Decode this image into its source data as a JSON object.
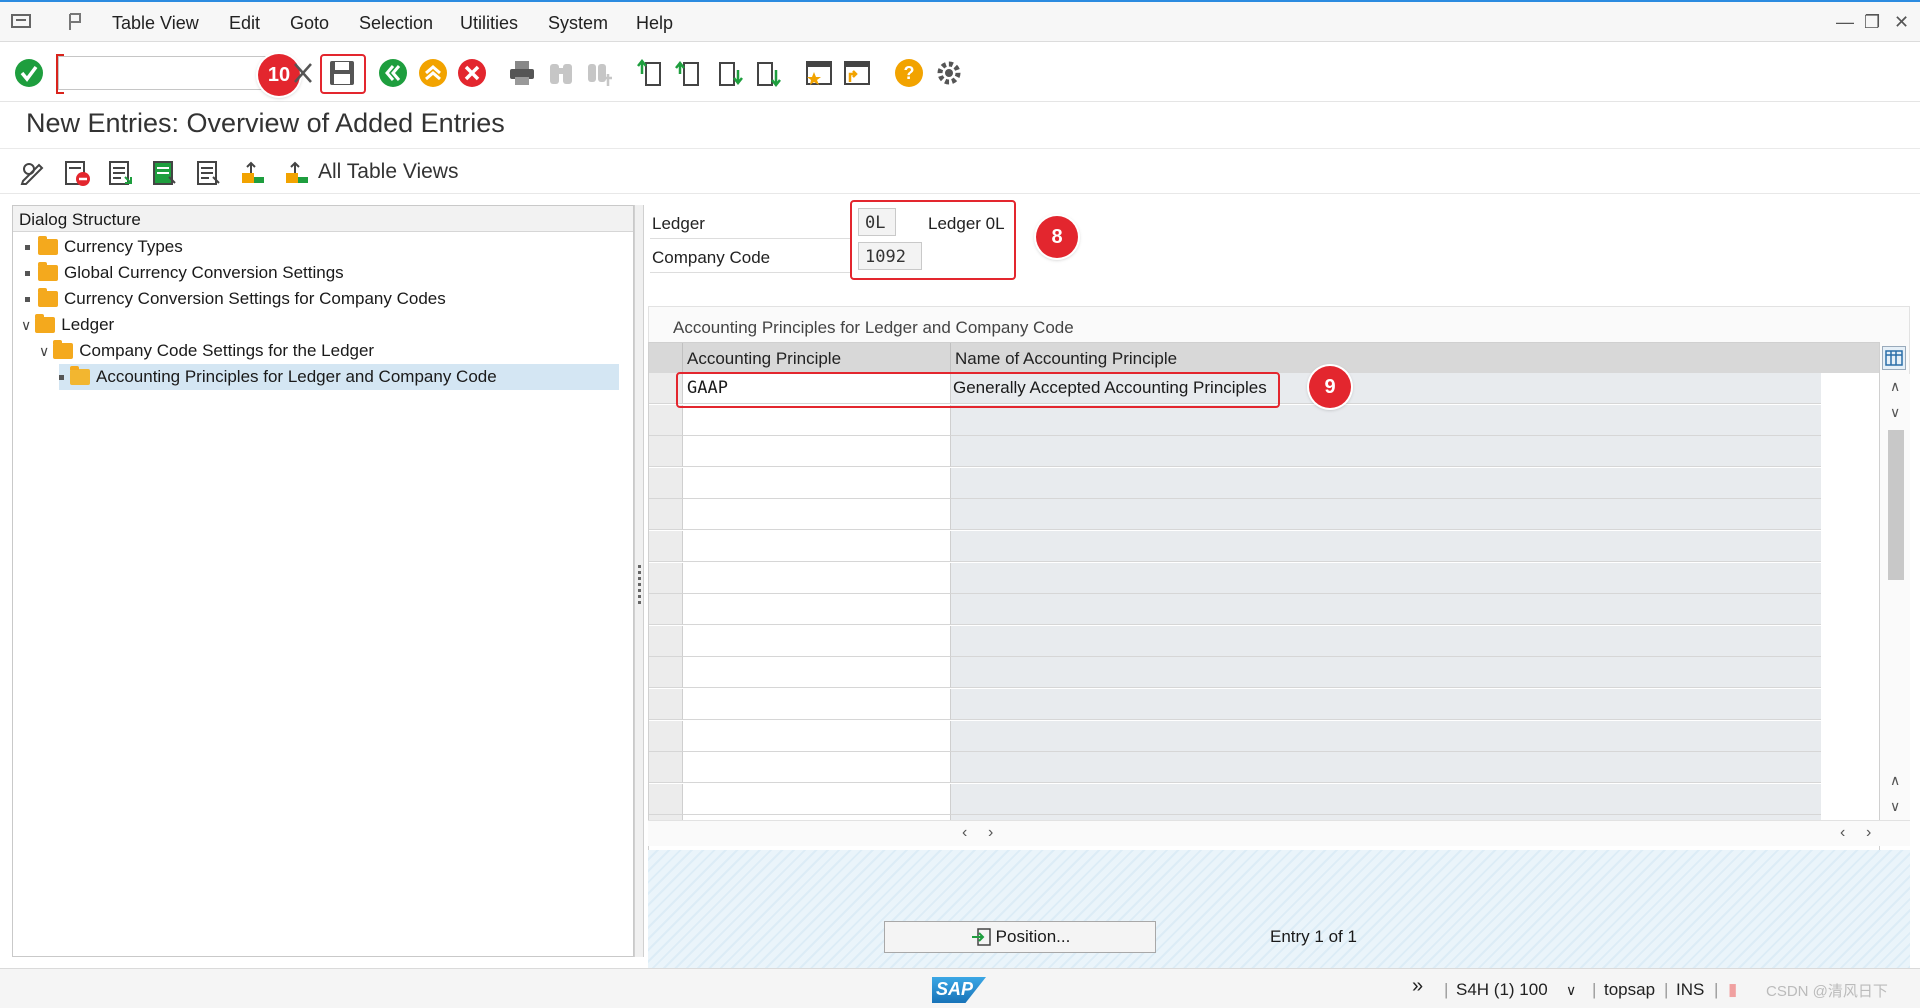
{
  "menubar": {
    "items": [
      "Table View",
      "Edit",
      "Goto",
      "Selection",
      "Utilities",
      "System",
      "Help"
    ]
  },
  "toolbar": {
    "command_value": "",
    "annotation_10": "10"
  },
  "page": {
    "title": "New Entries: Overview of Added Entries",
    "all_table_views": "All Table Views"
  },
  "dialog_structure": {
    "header": "Dialog Structure",
    "items": [
      {
        "label": "Currency Types"
      },
      {
        "label": "Global Currency Conversion Settings"
      },
      {
        "label": "Currency Conversion Settings for Company Codes"
      },
      {
        "label": "Ledger"
      },
      {
        "label": "Company Code Settings for the Ledger"
      },
      {
        "label": "Accounting Principles for Ledger and Company Code"
      }
    ]
  },
  "header_fields": {
    "ledger_label": "Ledger",
    "ledger_value": "0L",
    "ledger_desc": "Ledger 0L",
    "company_code_label": "Company Code",
    "company_code_value": "1092",
    "annotation_8": "8"
  },
  "table": {
    "group_title": "Accounting Principles for Ledger and Company Code",
    "columns": [
      "Accounting Principle",
      "Name of Accounting Principle"
    ],
    "rows": [
      {
        "principle": "GAAP",
        "name": "Generally Accepted Accounting Principles"
      }
    ],
    "annotation_9": "9"
  },
  "footer": {
    "position_button": "Position...",
    "entry_text": "Entry 1 of 1"
  },
  "statusbar": {
    "logo": "SAP",
    "system": "S4H (1) 100",
    "server": "topsap",
    "mode": "INS",
    "watermark": "CSDN @清风日下"
  },
  "colors": {
    "accent": "#2b8be0",
    "annotation": "#e3262e",
    "folder": "#f4a91d",
    "selected_row": "#d4e6f3"
  }
}
